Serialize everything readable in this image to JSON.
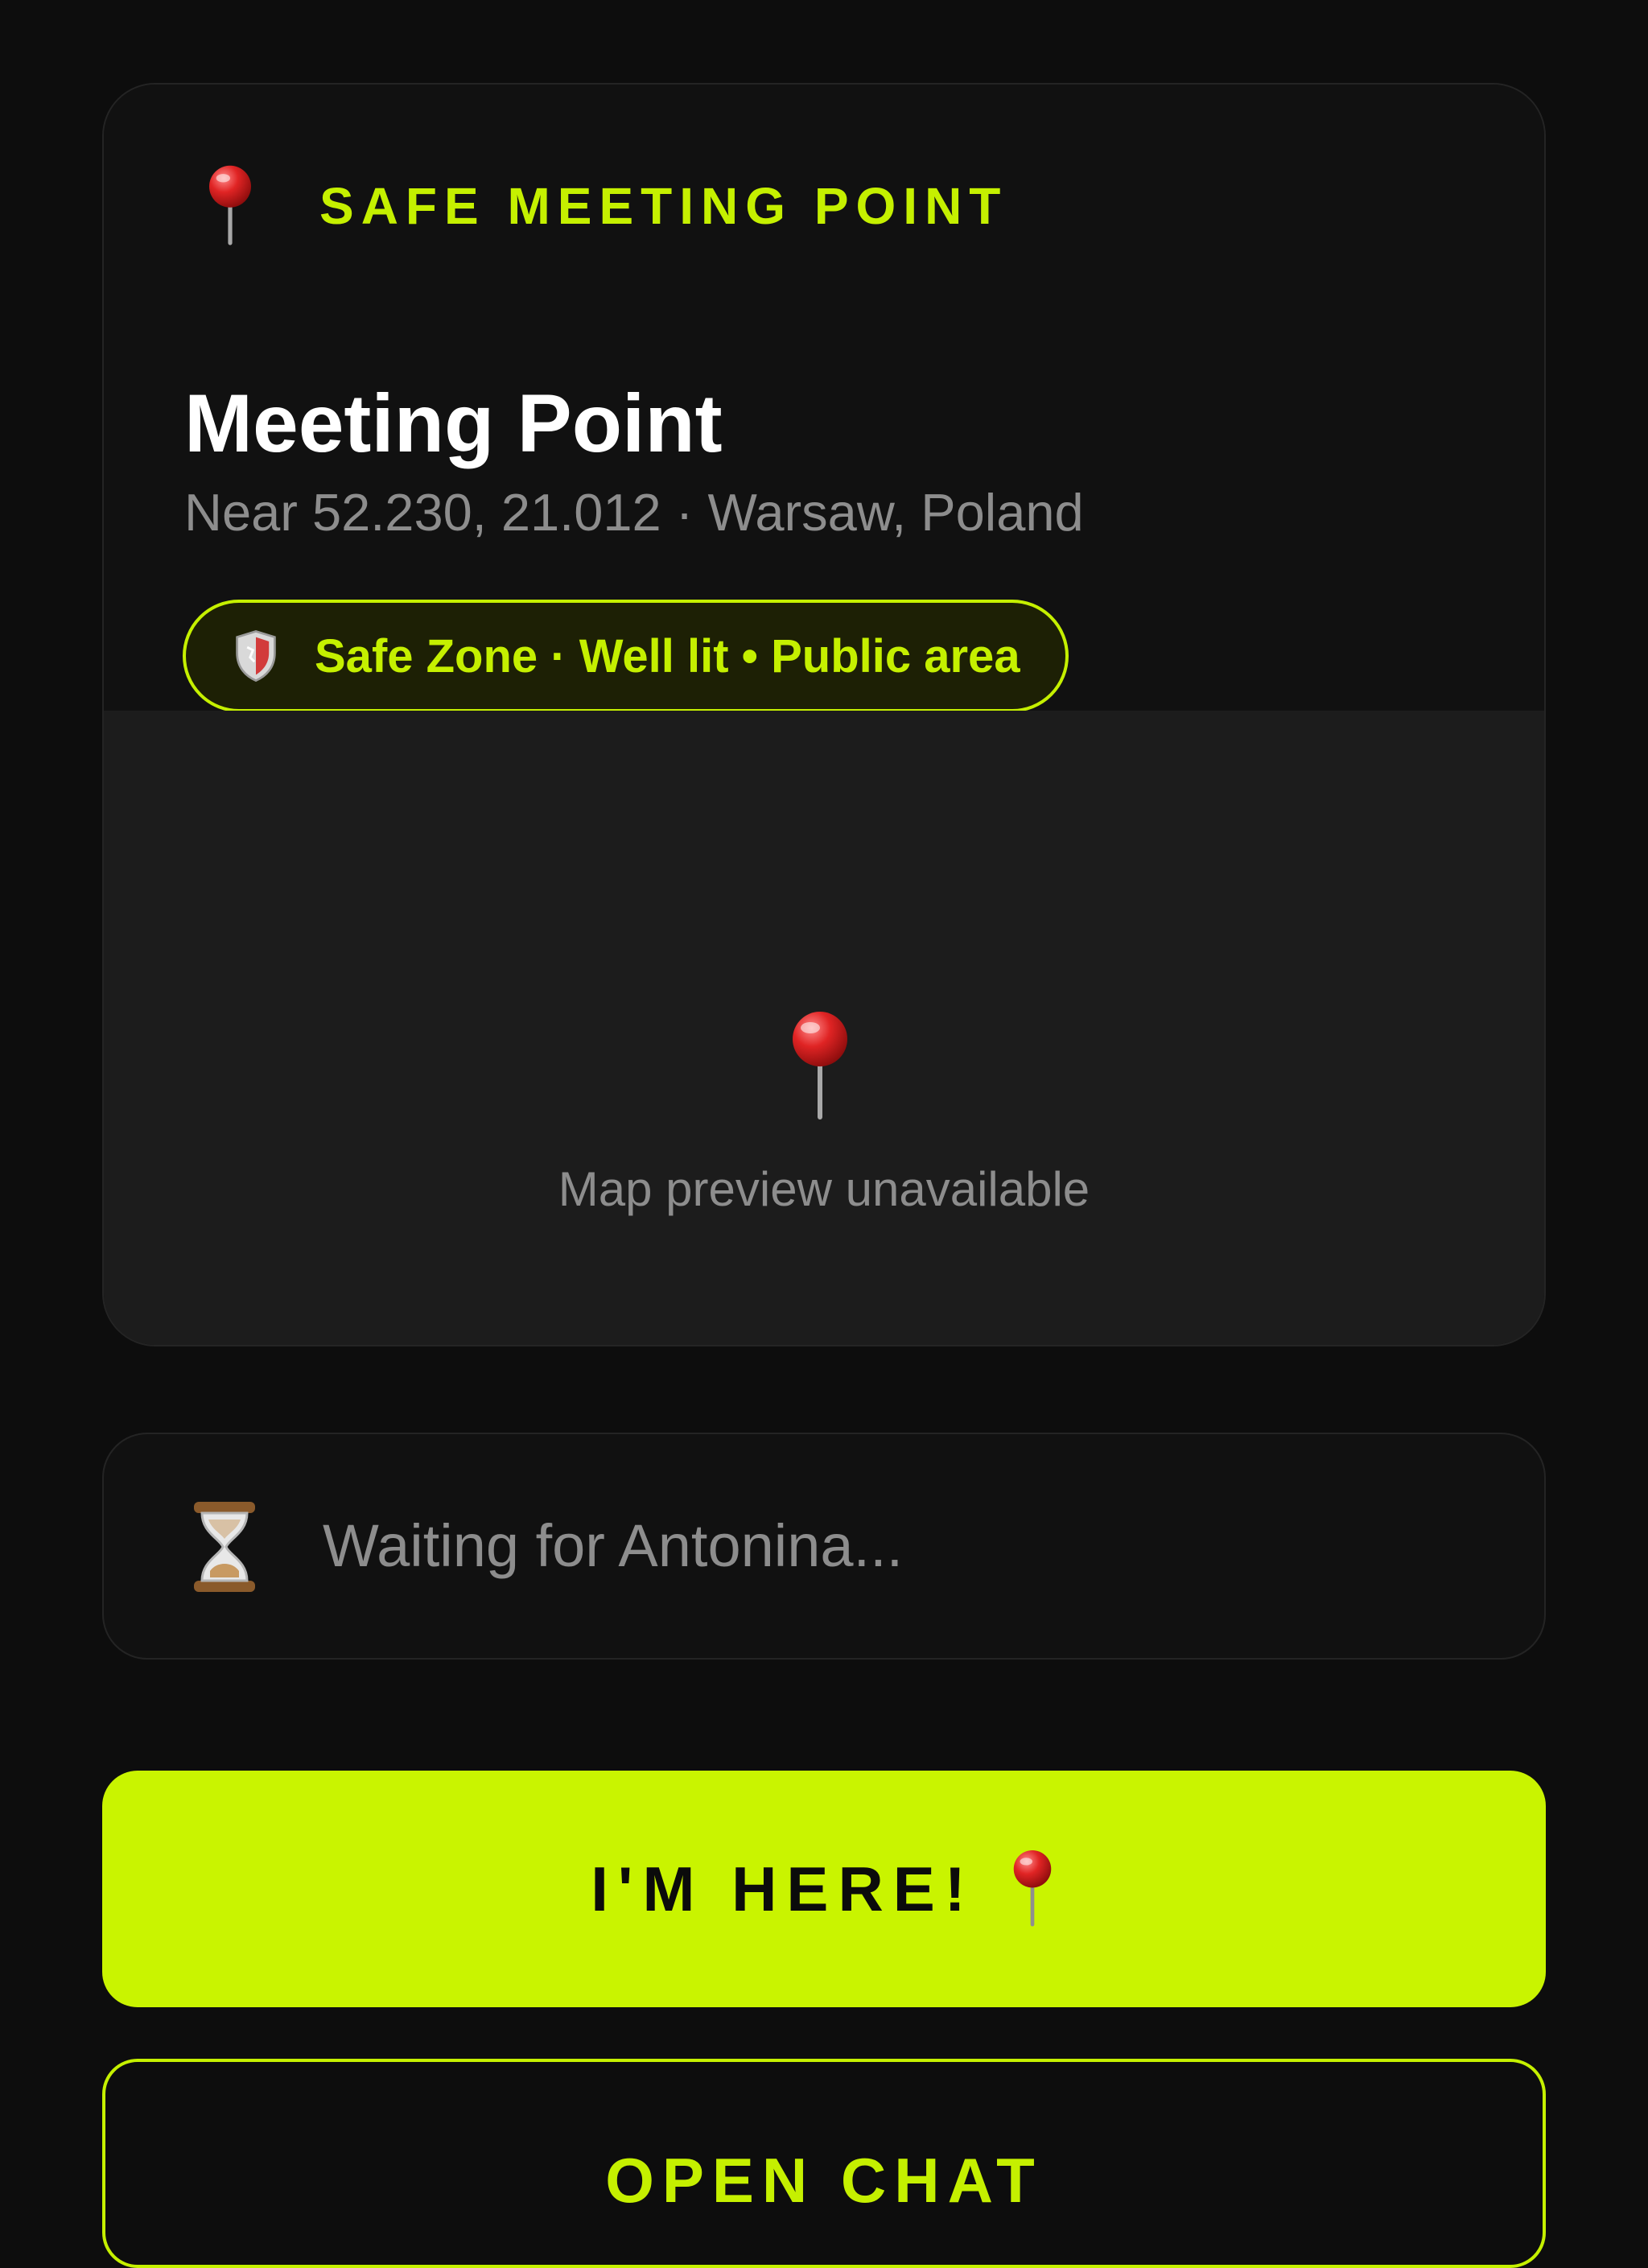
{
  "meeting": {
    "eyebrow_icon": "round-pushpin-icon",
    "eyebrow": "SAFE MEETING POINT",
    "title": "Meeting Point",
    "subtitle": "Near 52.230, 21.012 · Warsaw, Poland",
    "zone_badge": {
      "icon": "shield-icon",
      "label": "Safe Zone · Well lit • Public area"
    },
    "map": {
      "icon": "round-pushpin-icon",
      "message": "Map preview unavailable"
    }
  },
  "status": {
    "icon": "hourglass-icon",
    "text": "Waiting for Antonina..."
  },
  "actions": {
    "primary_label": "I'M HERE!",
    "primary_icon": "round-pushpin-icon",
    "secondary_label": "OPEN CHAT"
  },
  "colors": {
    "background": "#0d0d0d",
    "card": "#111111",
    "map_area": "#1c1c1c",
    "accent": "#c9f400",
    "muted_text": "#8d8d8d",
    "pin_red": "#e02424"
  }
}
